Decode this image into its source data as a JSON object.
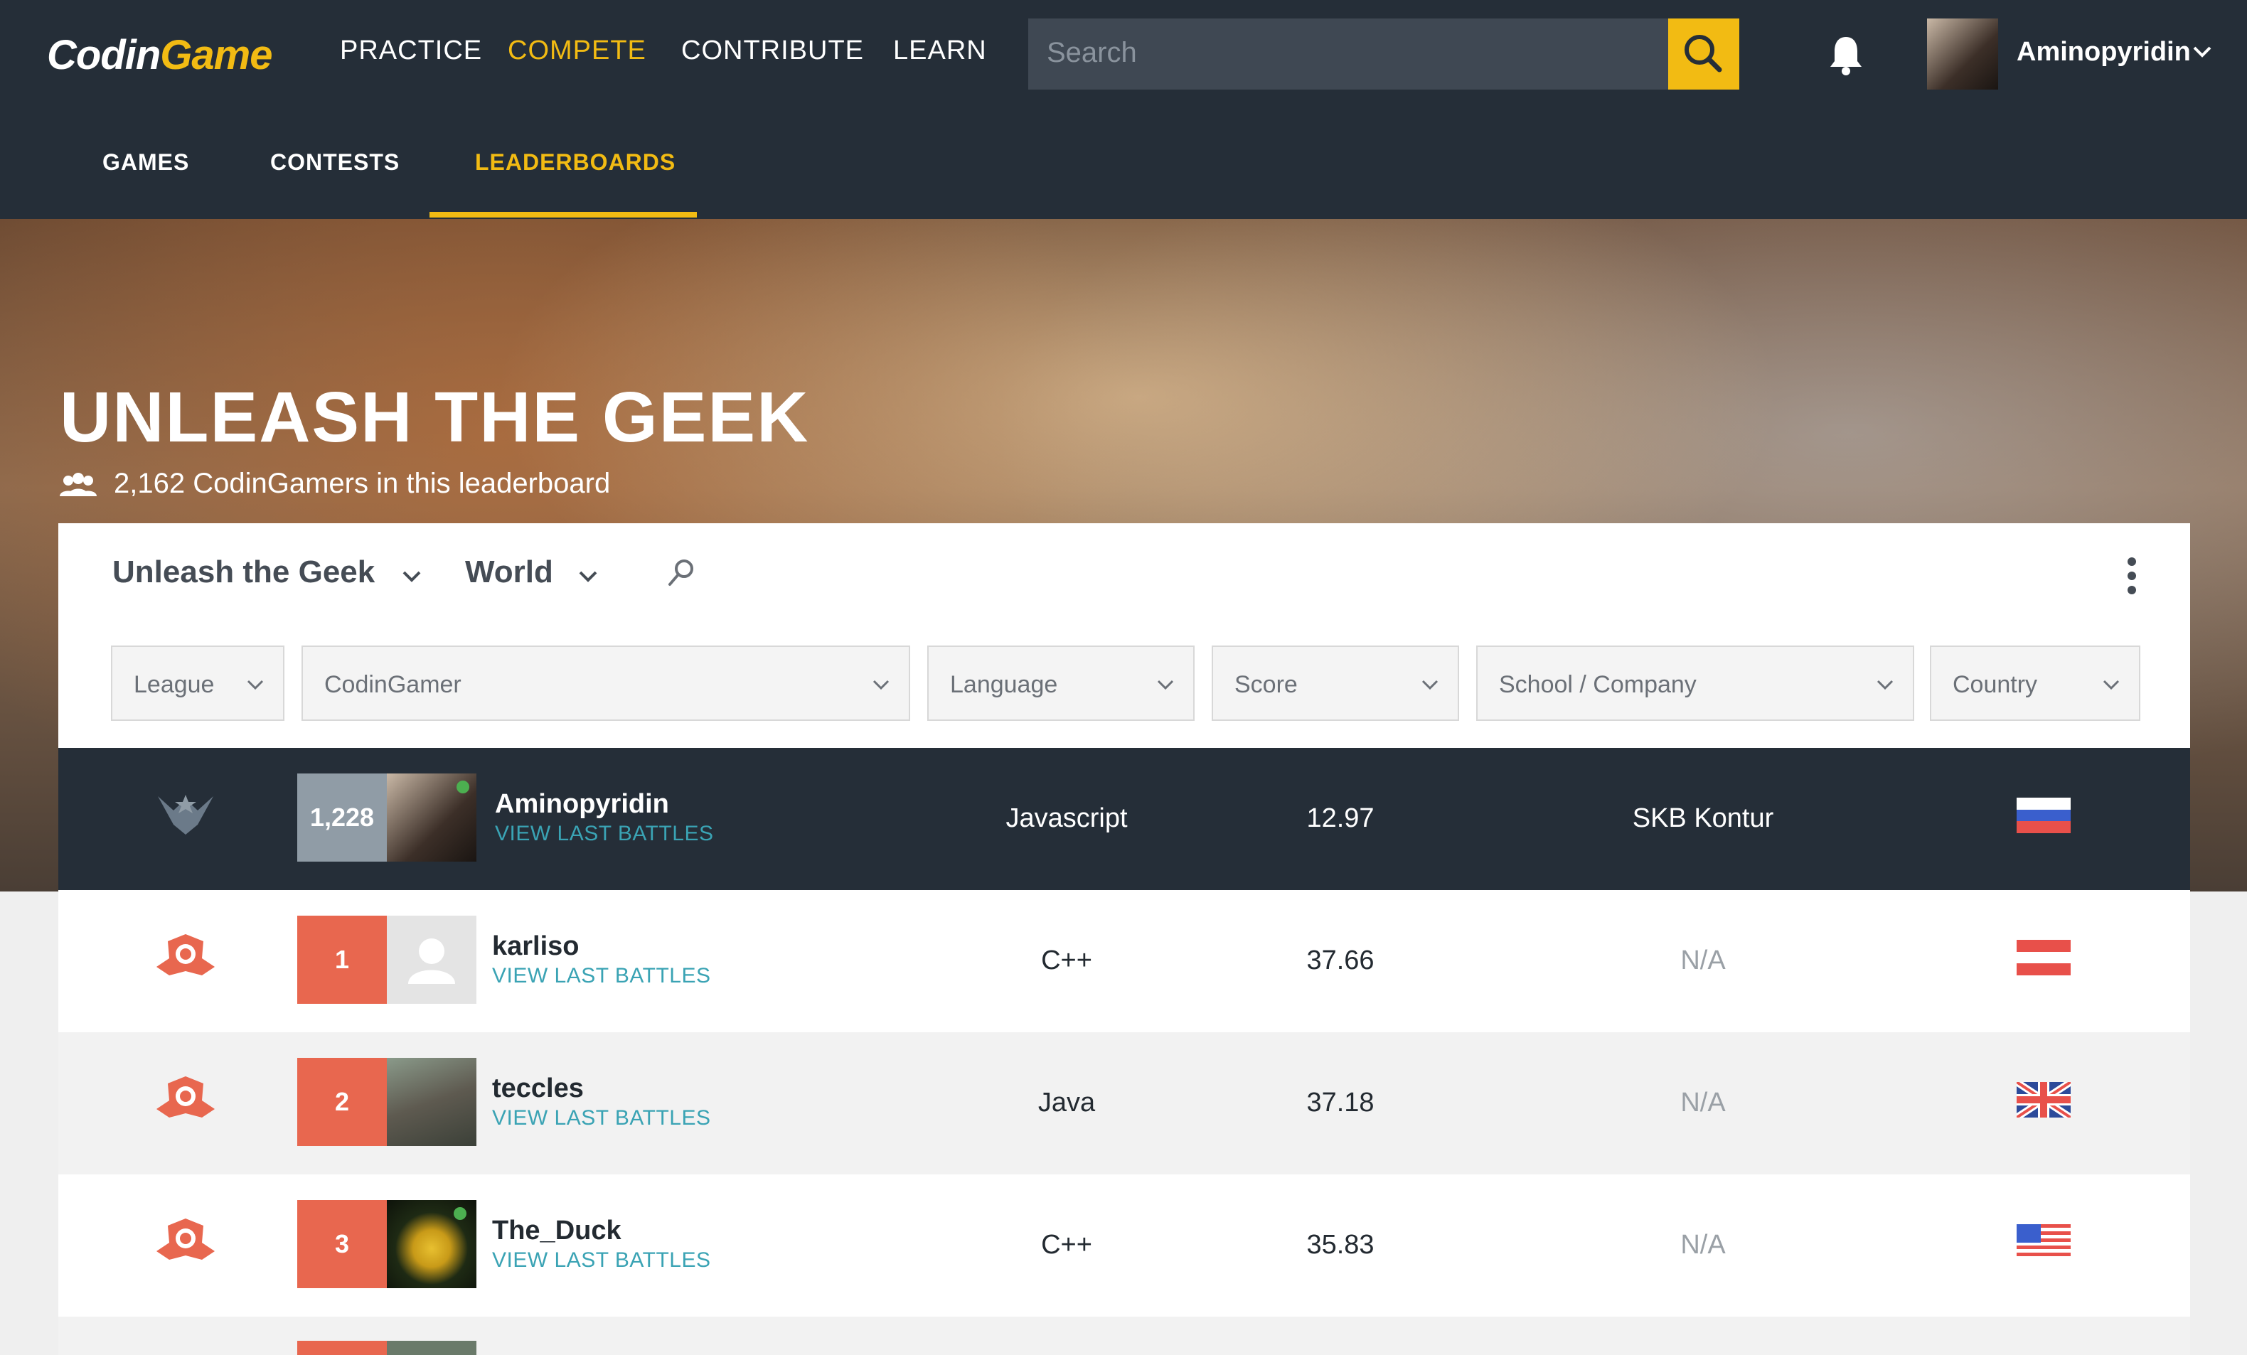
{
  "brand": {
    "logo_text_a": "Codin",
    "logo_text_b": "Game"
  },
  "nav": {
    "practice": "PRACTICE",
    "compete": "COMPETE",
    "contribute": "CONTRIBUTE",
    "learn": "LEARN"
  },
  "search": {
    "placeholder": "Search"
  },
  "user": {
    "name": "Aminopyridin"
  },
  "subnav": {
    "games": "GAMES",
    "contests": "CONTESTS",
    "leaderboards": "LEADERBOARDS"
  },
  "hero": {
    "title": "UNLEASH THE GEEK",
    "count": "2,162 CodinGamers in this leaderboard"
  },
  "board": {
    "selector": "Unleash the Geek",
    "region": "World"
  },
  "filters": {
    "league": "League",
    "codingamer": "CodinGamer",
    "language": "Language",
    "score": "Score",
    "school": "School / Company",
    "country": "Country"
  },
  "rows": [
    {
      "rank": "1,228",
      "name": "Aminopyridin",
      "link": "VIEW LAST BATTLES",
      "language": "Javascript",
      "score": "12.97",
      "company": "SKB Kontur",
      "country_flag": "russia"
    },
    {
      "rank": "1",
      "name": "karliso",
      "link": "VIEW LAST BATTLES",
      "language": "C++",
      "score": "37.66",
      "company": "N/A",
      "country_flag": "austria"
    },
    {
      "rank": "2",
      "name": "teccles",
      "link": "VIEW LAST BATTLES",
      "language": "Java",
      "score": "37.18",
      "company": "N/A",
      "country_flag": "united-kingdom"
    },
    {
      "rank": "3",
      "name": "The_Duck",
      "link": "VIEW LAST BATTLES",
      "language": "C++",
      "score": "35.83",
      "company": "N/A",
      "country_flag": "united-states"
    }
  ],
  "colors": {
    "dark": "#252e38",
    "accent": "#f2bb13",
    "rank_red": "#e8674f",
    "link": "#3aa3b4"
  }
}
